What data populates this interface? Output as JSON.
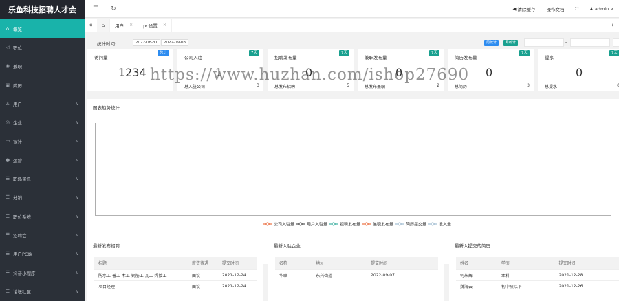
{
  "app": {
    "logo": "乐鱼科技招聘人才会"
  },
  "sidebar": {
    "items": [
      {
        "label": "概览",
        "icon": "home-icon",
        "glyph": "⌂",
        "active": true,
        "expandable": false
      },
      {
        "label": "职位",
        "icon": "send-icon",
        "glyph": "◁",
        "active": false,
        "expandable": false
      },
      {
        "label": "兼职",
        "icon": "clock-icon",
        "glyph": "◉",
        "active": false,
        "expandable": false
      },
      {
        "label": "简历",
        "icon": "document-icon",
        "glyph": "▣",
        "active": false,
        "expandable": false
      },
      {
        "label": "用户",
        "icon": "user-icon",
        "glyph": "♙",
        "active": false,
        "expandable": true
      },
      {
        "label": "企业",
        "icon": "company-icon",
        "glyph": "◎",
        "active": false,
        "expandable": true
      },
      {
        "label": "设计",
        "icon": "design-icon",
        "glyph": "▭",
        "active": false,
        "expandable": true
      },
      {
        "label": "运营",
        "icon": "operation-icon",
        "glyph": "●",
        "active": false,
        "expandable": true
      },
      {
        "label": "职场资讯",
        "icon": "news-icon",
        "glyph": "☰",
        "active": false,
        "expandable": true
      },
      {
        "label": "分销",
        "icon": "share-icon",
        "glyph": "☰",
        "active": false,
        "expandable": true
      },
      {
        "label": "职位系统",
        "icon": "system-icon",
        "glyph": "☰",
        "active": false,
        "expandable": true
      },
      {
        "label": "招聘会",
        "icon": "fair-icon",
        "glyph": "☰",
        "active": false,
        "expandable": true
      },
      {
        "label": "用户PC端",
        "icon": "pc-icon",
        "glyph": "☰",
        "active": false,
        "expandable": true
      },
      {
        "label": "抖音小程序",
        "icon": "miniapp-icon",
        "glyph": "☰",
        "active": false,
        "expandable": true
      },
      {
        "label": "论坛社区",
        "icon": "forum-icon",
        "glyph": "☰",
        "active": false,
        "expandable": true
      }
    ]
  },
  "topbar": {
    "clear_cache": "清除缓存",
    "docs": "操作文档",
    "user": "admin"
  },
  "tabs": [
    {
      "label": "用户",
      "closable": true
    },
    {
      "label": "pc设置",
      "closable": true
    }
  ],
  "filter": {
    "label": "统计时间:",
    "start": "2022-08-31",
    "end": "2022-09-08",
    "week_btn": "周统计",
    "month_btn": "月统计",
    "range_sep": "-"
  },
  "cards": [
    {
      "title": "访问量",
      "badge": "总计",
      "badge_color": "#2d8cf0",
      "number": "1234",
      "sub": "",
      "count": ""
    },
    {
      "title": "公司入驻",
      "badge": "7天",
      "badge_color": "#19a08f",
      "number": "1",
      "sub": "总入驻公司",
      "count": "3"
    },
    {
      "title": "招聘发布量",
      "badge": "7天",
      "badge_color": "#19a08f",
      "number": "0",
      "sub": "总发布招聘",
      "count": "5"
    },
    {
      "title": "兼职发布量",
      "badge": "7天",
      "badge_color": "#19a08f",
      "number": "0",
      "sub": "总发布兼职",
      "count": "2"
    },
    {
      "title": "简历发布量",
      "badge": "7天",
      "badge_color": "#19a08f",
      "number": "0",
      "sub": "总简历",
      "count": "3"
    },
    {
      "title": "提水",
      "badge": "7天",
      "badge_color": "#19a08f",
      "number": "0",
      "sub": "总提水",
      "count": "0"
    }
  ],
  "chart": {
    "title": "图表趋势统计",
    "legend": [
      {
        "name": "公司入驻量",
        "color": "#e8541e"
      },
      {
        "name": "用户入驻量",
        "color": "#333333"
      },
      {
        "name": "招聘发布量",
        "color": "#19a08f"
      },
      {
        "name": "兼职发布量",
        "color": "#e8541e"
      },
      {
        "name": "简历提交量",
        "color": "#8fb0c8"
      },
      {
        "name": "收入量",
        "color": "#8fb0c8"
      }
    ]
  },
  "chart_data": {
    "type": "line",
    "title": "图表趋势统计",
    "x": [],
    "series": [
      {
        "name": "公司入驻量",
        "values": []
      },
      {
        "name": "用户入驻量",
        "values": []
      },
      {
        "name": "招聘发布量",
        "values": []
      },
      {
        "name": "兼职发布量",
        "values": []
      },
      {
        "name": "简历提交量",
        "values": []
      },
      {
        "name": "收入量",
        "values": []
      }
    ],
    "legend_position": "bottom",
    "grid": false
  },
  "panels": {
    "jobs": {
      "title": "最新发布招聘",
      "headers": [
        "标题",
        "薪资待遇",
        "提交时间"
      ],
      "rows": [
        [
          "防水工 普工 木工 钢筋工 瓦工 焊接工",
          "面议",
          "2021-12-24"
        ],
        [
          "项目经理",
          "面议",
          "2021-12-24"
        ]
      ]
    },
    "companies": {
      "title": "最新入驻企业",
      "headers": [
        "名称",
        "地址",
        "提交时间"
      ],
      "rows": [
        [
          "华联",
          "东兴街道",
          "2022-09-07"
        ]
      ]
    },
    "resumes": {
      "title": "最新入提交的简历",
      "headers": [
        "姓名",
        "学历",
        "提交时间"
      ],
      "rows": [
        [
          "何永辉",
          "本科",
          "2021-12-28"
        ],
        [
          "魏海云",
          "初中及以下",
          "2021-12-26"
        ]
      ]
    }
  },
  "watermark": "https://www.huzhan.com/ishop27690"
}
